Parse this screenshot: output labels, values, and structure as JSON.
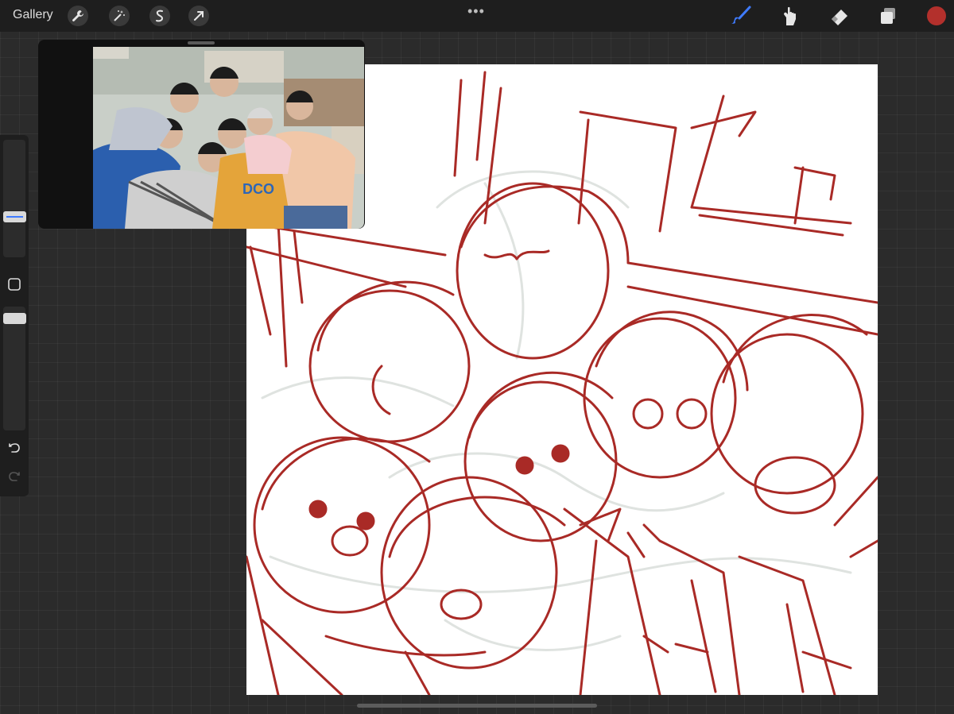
{
  "toolbar": {
    "gallery_label": "Gallery",
    "more_label": "•••",
    "left_tools": [
      "wrench-icon",
      "magic-wand-icon",
      "selection-icon",
      "transform-arrow-icon"
    ],
    "right_tools": [
      "brush-icon",
      "smudge-icon",
      "eraser-icon",
      "layers-icon"
    ],
    "active_tool": "brush-icon",
    "brush_color": "#b3302c"
  },
  "colors": {
    "accent": "#3f7bff",
    "sketch_red": "#b3302c",
    "canvas": "#ffffff",
    "background": "#2b2b2b"
  },
  "sidebar": {
    "size_slider_value": 0.34,
    "opacity_slider_value": 0.98,
    "buttons": [
      "modify-square-icon",
      "undo-icon",
      "redo-icon"
    ]
  },
  "reference": {
    "shirt_text": "DCO"
  }
}
